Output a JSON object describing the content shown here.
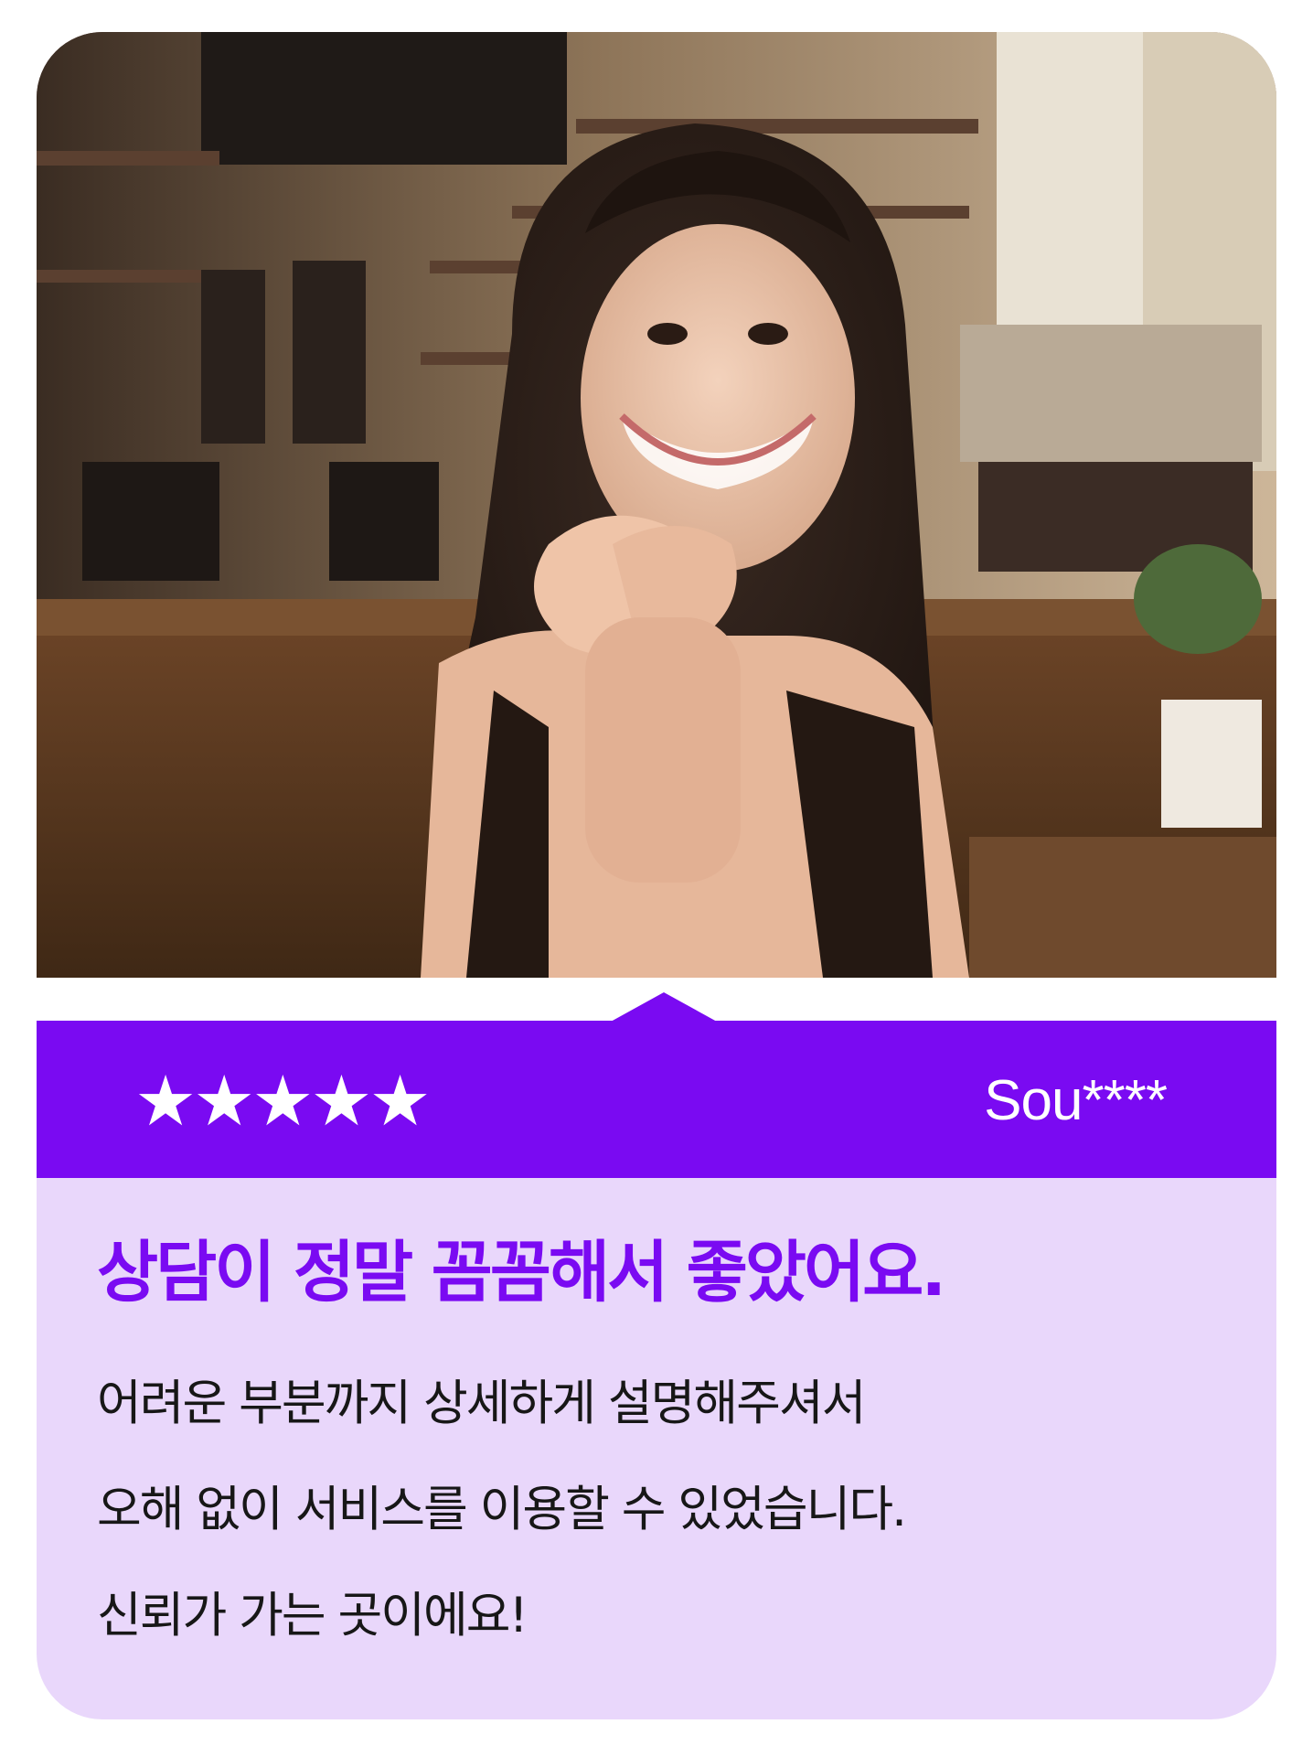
{
  "review": {
    "stars": "★★★★★",
    "rating_value": 5,
    "rating_max": 5,
    "reviewer": "Sou****",
    "headline": "상담이 정말 꼼꼼해서 좋았어요.",
    "body_lines": [
      "어려운 부분까지 상세하게 설명해주셔서",
      "오해 없이 서비스를 이용할 수 있었습니다.",
      "신뢰가 가는 곳이에요!"
    ]
  },
  "colors": {
    "accent": "#7a0af2",
    "card_background": "#e9d7fb",
    "body_text": "#171717",
    "on_accent_text": "#ffffff"
  }
}
